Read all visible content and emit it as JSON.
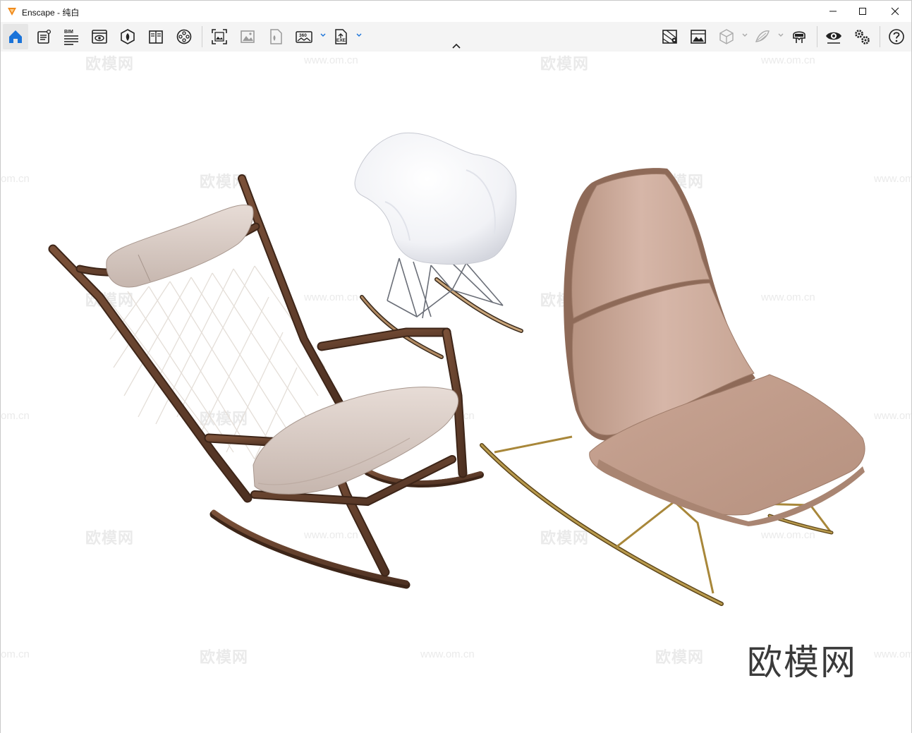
{
  "window": {
    "title": "Enscape - 纯白"
  },
  "toolbar": {
    "left_tools": [
      {
        "name": "home-icon",
        "active": true
      },
      {
        "name": "asset-library-icon",
        "active": false
      },
      {
        "name": "bim-icon",
        "active": false,
        "label": "BIM"
      },
      {
        "name": "view-icon",
        "active": false
      },
      {
        "name": "material-icon",
        "active": false
      },
      {
        "name": "book-icon",
        "active": false
      },
      {
        "name": "video-icon",
        "active": false
      }
    ],
    "capture_tools": [
      {
        "name": "screenshot-icon"
      },
      {
        "name": "batch-render-icon"
      },
      {
        "name": "panorama-icon"
      },
      {
        "name": "360-icon",
        "label": "360"
      },
      {
        "name": "exe-export-icon",
        "label": "EXE"
      }
    ],
    "right_tools": [
      {
        "name": "map-icon"
      },
      {
        "name": "visual-settings-icon"
      },
      {
        "name": "cube-icon"
      },
      {
        "name": "sketch-icon"
      },
      {
        "name": "vr-headset-icon"
      },
      {
        "name": "eye-icon"
      },
      {
        "name": "settings-icon"
      },
      {
        "name": "help-icon"
      }
    ]
  },
  "viewport": {
    "watermark_text": "欧模网",
    "watermark_url": "www.om.cn",
    "watermark_url_partial": "om.cn",
    "watermark_main": "欧模网"
  },
  "colors": {
    "accent": "#1a73d9",
    "logo_orange": "#f08a1c",
    "wood": "#6b4530",
    "cushion": "#d8cbc4",
    "pink_leather": "#c9a696",
    "brass": "#a8873a"
  }
}
